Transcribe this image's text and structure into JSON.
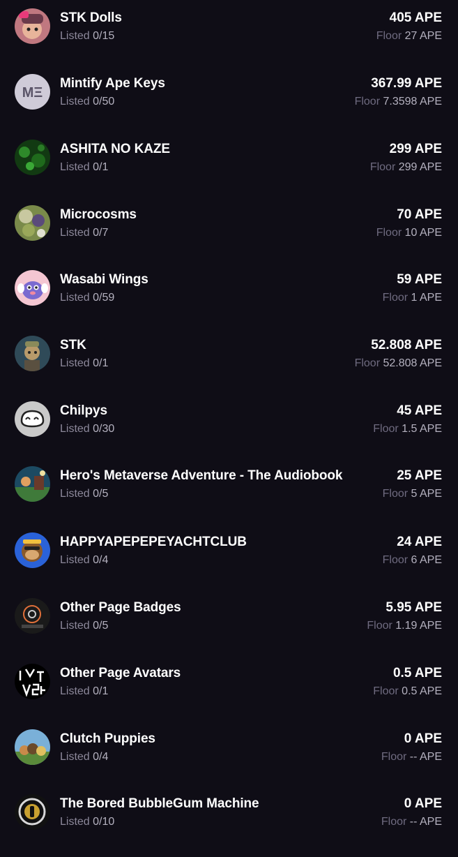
{
  "collections": [
    {
      "name": "STK Dolls",
      "listed_label": "Listed",
      "listed": "0/15",
      "price": "405 APE",
      "floor_label": "Floor",
      "floor": "27 APE",
      "avatar": "stk-dolls-avatar"
    },
    {
      "name": "Mintify Ape Keys",
      "listed_label": "Listed",
      "listed": "0/50",
      "price": "367.99 APE",
      "floor_label": "Floor",
      "floor": "7.3598 APE",
      "avatar": "mintify-logo-avatar",
      "avatar_text": "MΞ"
    },
    {
      "name": "ASHITA NO KAZE",
      "listed_label": "Listed",
      "listed": "0/1",
      "price": "299 APE",
      "floor_label": "Floor",
      "floor": "299 APE",
      "avatar": "ashita-avatar"
    },
    {
      "name": "Microcosms",
      "listed_label": "Listed",
      "listed": "0/7",
      "price": "70 APE",
      "floor_label": "Floor",
      "floor": "10 APE",
      "avatar": "microcosms-avatar"
    },
    {
      "name": "Wasabi Wings",
      "listed_label": "Listed",
      "listed": "0/59",
      "price": "59 APE",
      "floor_label": "Floor",
      "floor": "1 APE",
      "avatar": "wasabi-wings-avatar"
    },
    {
      "name": "STK",
      "listed_label": "Listed",
      "listed": "0/1",
      "price": "52.808 APE",
      "floor_label": "Floor",
      "floor": "52.808 APE",
      "avatar": "stk-avatar"
    },
    {
      "name": "Chilpys",
      "listed_label": "Listed",
      "listed": "0/30",
      "price": "45 APE",
      "floor_label": "Floor",
      "floor": "1.5 APE",
      "avatar": "chilpys-avatar"
    },
    {
      "name": "Hero's Metaverse Adventure - The Audiobook",
      "listed_label": "Listed",
      "listed": "0/5",
      "price": "25 APE",
      "floor_label": "Floor",
      "floor": "5 APE",
      "avatar": "hero-audiobook-avatar"
    },
    {
      "name": "HAPPYAPEPEPEYACHTCLUB",
      "listed_label": "Listed",
      "listed": "0/4",
      "price": "24 APE",
      "floor_label": "Floor",
      "floor": "6 APE",
      "avatar": "happy-ape-avatar"
    },
    {
      "name": "Other Page Badges",
      "listed_label": "Listed",
      "listed": "0/5",
      "price": "5.95 APE",
      "floor_label": "Floor",
      "floor": "1.19 APE",
      "avatar": "other-page-badges-avatar"
    },
    {
      "name": "Other Page Avatars",
      "listed_label": "Listed",
      "listed": "0/1",
      "price": "0.5 APE",
      "floor_label": "Floor",
      "floor": "0.5 APE",
      "avatar": "other-page-avatars-avatar"
    },
    {
      "name": "Clutch Puppies",
      "listed_label": "Listed",
      "listed": "0/4",
      "price": "0 APE",
      "floor_label": "Floor",
      "floor": "-- APE",
      "avatar": "clutch-puppies-avatar"
    },
    {
      "name": "The Bored BubbleGum Machine",
      "listed_label": "Listed",
      "listed": "0/10",
      "price": "0 APE",
      "floor_label": "Floor",
      "floor": "-- APE",
      "avatar": "bubblegum-machine-avatar"
    }
  ]
}
